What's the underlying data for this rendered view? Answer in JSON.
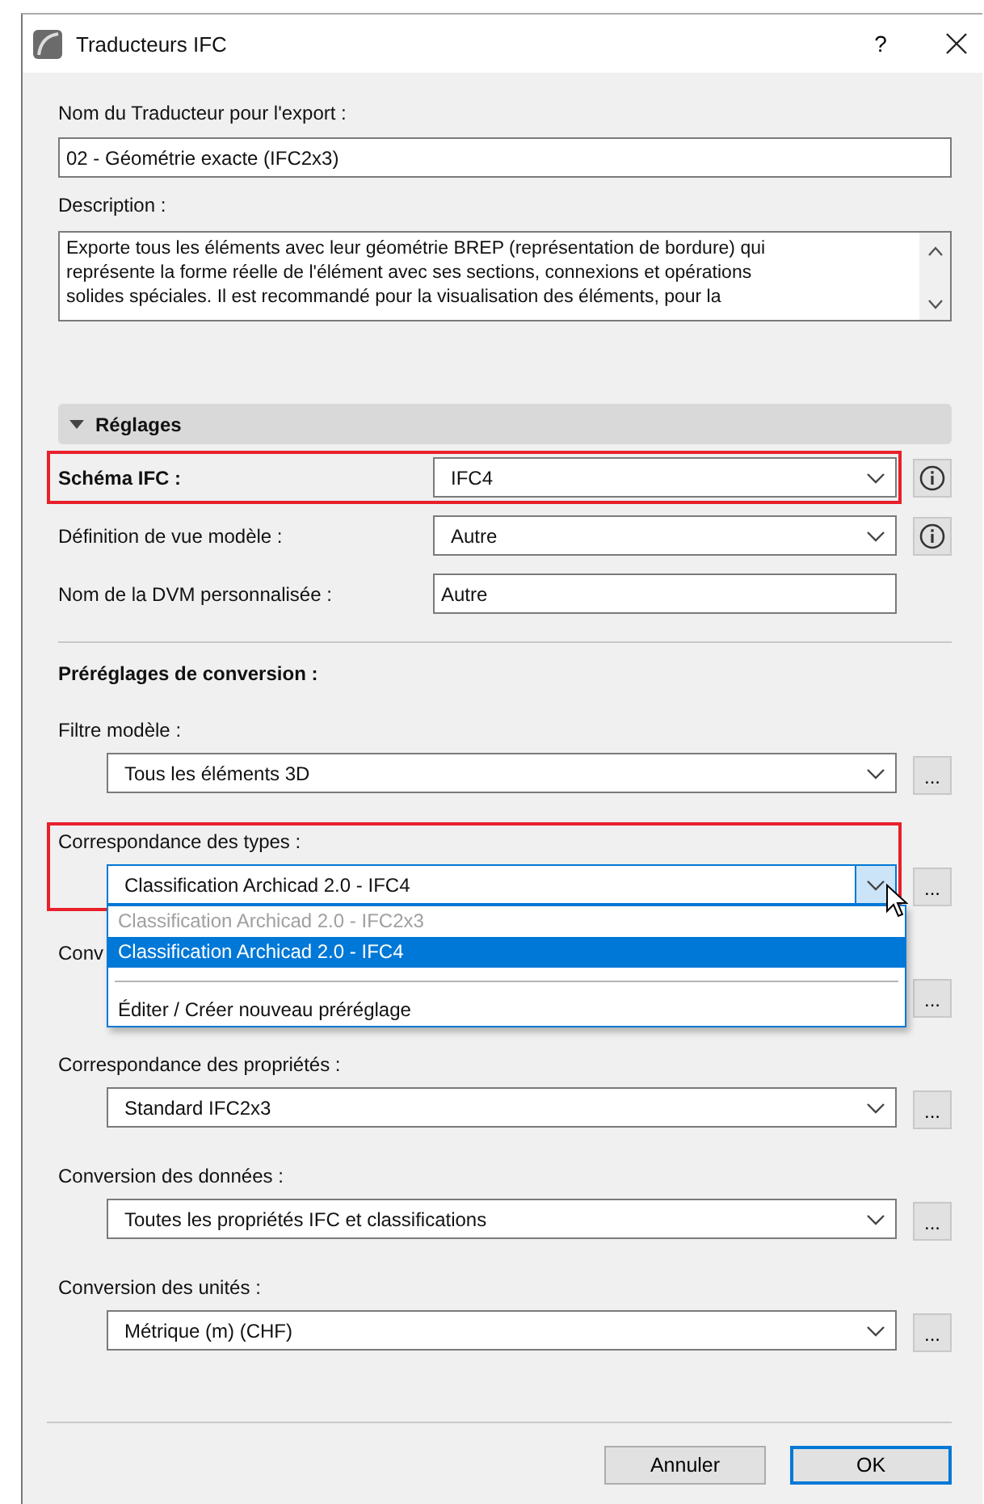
{
  "window": {
    "title": "Traducteurs IFC",
    "help": "?"
  },
  "name_field": {
    "label": "Nom du Traducteur pour l'export :",
    "value": "02 - Géométrie exacte (IFC2x3)"
  },
  "description": {
    "label": "Description :",
    "lines": [
      "Exporte tous les éléments avec leur géométrie BREP (représentation de bordure) qui",
      "représente la forme réelle de l'élément avec ses sections, connexions et opérations",
      "solides spéciales. Il est recommandé pour la visualisation des éléments, pour la"
    ]
  },
  "settings": {
    "title": "Réglages",
    "expanded": true,
    "rows": [
      {
        "kind": "select",
        "label": "Schéma IFC :",
        "value": "IFC4",
        "emphasized": true,
        "highlighted": true,
        "info": true
      },
      {
        "kind": "select",
        "label": "Définition de vue modèle :",
        "value": "Autre",
        "emphasized": false,
        "highlighted": false,
        "info": true
      },
      {
        "kind": "input",
        "label": "Nom de la DVM personnalisée :",
        "value": "Autre",
        "emphasized": false,
        "highlighted": false,
        "info": false
      }
    ]
  },
  "presets": {
    "title": "Préréglages de conversion :",
    "groups": [
      {
        "label": "Filtre modèle :",
        "value": "Tous les éléments 3D",
        "highlighted": false,
        "more": "..."
      },
      {
        "label": "Correspondance des types :",
        "value": "Classification Archicad 2.0 - IFC4",
        "highlighted": true,
        "more": "...",
        "options": [
          {
            "kind": "option",
            "text": "Classification Archicad 2.0 - IFC2x3",
            "disabled": true,
            "selected": false
          },
          {
            "kind": "option",
            "text": "Classification Archicad 2.0 - IFC4",
            "disabled": false,
            "selected": true
          },
          {
            "kind": "blank"
          },
          {
            "kind": "separator"
          },
          {
            "kind": "option",
            "text": "Éditer / Créer nouveau préréglage",
            "disabled": false,
            "selected": false
          }
        ]
      },
      {
        "label": "Conv",
        "highlighted": false,
        "more": "..."
      },
      {
        "label": "Correspondance des propriétés :",
        "value": "Standard IFC2x3",
        "highlighted": false,
        "more": "..."
      },
      {
        "label": "Conversion des données :",
        "value": "Toutes les propriétés IFC et classifications",
        "highlighted": false,
        "more": "..."
      },
      {
        "label": "Conversion des unités :",
        "value": "Métrique (m) (CHF)",
        "highlighted": false,
        "more": "..."
      }
    ]
  },
  "buttons": [
    {
      "label": "Annuler",
      "default": false
    },
    {
      "label": "OK",
      "default": true
    }
  ]
}
